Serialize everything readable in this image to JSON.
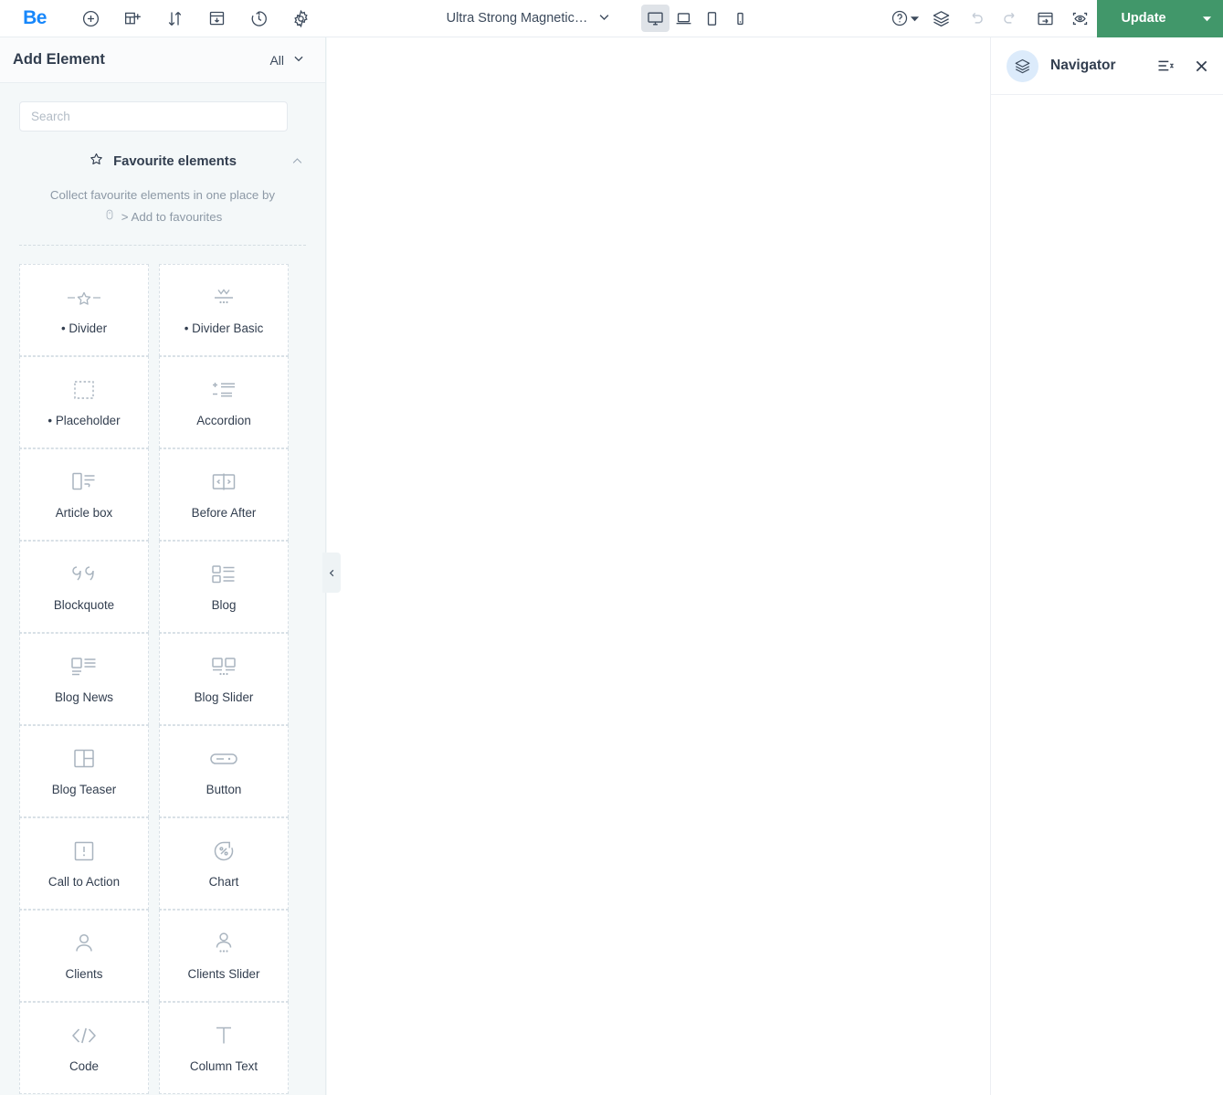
{
  "topbar": {
    "logo": "Be",
    "left_icons": [
      {
        "name": "add-circle-icon",
        "label": "Add"
      },
      {
        "name": "add-section-icon",
        "label": "Add section"
      },
      {
        "name": "sort-icon",
        "label": "Reorder"
      },
      {
        "name": "save-template-icon",
        "label": "Save template"
      },
      {
        "name": "history-icon",
        "label": "Revisions"
      },
      {
        "name": "settings-gear-icon",
        "label": "Settings"
      }
    ],
    "page_name": "Ultra Strong Magnetic…",
    "devices": [
      {
        "name": "desktop",
        "active": true
      },
      {
        "name": "laptop",
        "active": false
      },
      {
        "name": "tablet",
        "active": false
      },
      {
        "name": "mobile",
        "active": false
      }
    ],
    "right_icons": [
      {
        "name": "help-icon",
        "label": "Help"
      },
      {
        "name": "layers-icon",
        "label": "Navigator"
      },
      {
        "name": "undo-icon",
        "label": "Undo"
      },
      {
        "name": "redo-icon",
        "label": "Redo"
      },
      {
        "name": "export-icon",
        "label": "Export"
      },
      {
        "name": "preview-icon",
        "label": "Preview"
      }
    ],
    "update_label": "Update"
  },
  "left_panel": {
    "title": "Add Element",
    "filter_label": "All",
    "search": {
      "placeholder": "Search",
      "value": ""
    },
    "favourites": {
      "title": "Favourite elements",
      "description_line1": "Collect favourite elements in one place by",
      "description_line2": "> Add to favourites"
    },
    "elements": [
      {
        "label": "• Divider",
        "icon": "divider-star-icon"
      },
      {
        "label": "• Divider Basic",
        "icon": "divider-basic-icon"
      },
      {
        "label": "• Placeholder",
        "icon": "placeholder-icon"
      },
      {
        "label": "Accordion",
        "icon": "accordion-icon"
      },
      {
        "label": "Article box",
        "icon": "article-box-icon"
      },
      {
        "label": "Before After",
        "icon": "before-after-icon"
      },
      {
        "label": "Blockquote",
        "icon": "blockquote-icon"
      },
      {
        "label": "Blog",
        "icon": "blog-icon"
      },
      {
        "label": "Blog News",
        "icon": "blog-news-icon"
      },
      {
        "label": "Blog Slider",
        "icon": "blog-slider-icon"
      },
      {
        "label": "Blog Teaser",
        "icon": "blog-teaser-icon"
      },
      {
        "label": "Button",
        "icon": "button-icon"
      },
      {
        "label": "Call to Action",
        "icon": "call-to-action-icon"
      },
      {
        "label": "Chart",
        "icon": "chart-icon"
      },
      {
        "label": "Clients",
        "icon": "clients-icon"
      },
      {
        "label": "Clients Slider",
        "icon": "clients-slider-icon"
      },
      {
        "label": "Code",
        "icon": "code-icon"
      },
      {
        "label": "Column Text",
        "icon": "column-text-icon"
      }
    ]
  },
  "navigator": {
    "title": "Navigator",
    "badge_icon": "layers-icon",
    "list_icon": "list-options-icon",
    "close_icon": "close-icon"
  },
  "colors": {
    "accent_green": "#41976a",
    "logo_blue": "#1787fb",
    "panel_bg": "#f4f8f9",
    "text_dark": "#323e4f",
    "text_muted": "#8d99a6"
  }
}
